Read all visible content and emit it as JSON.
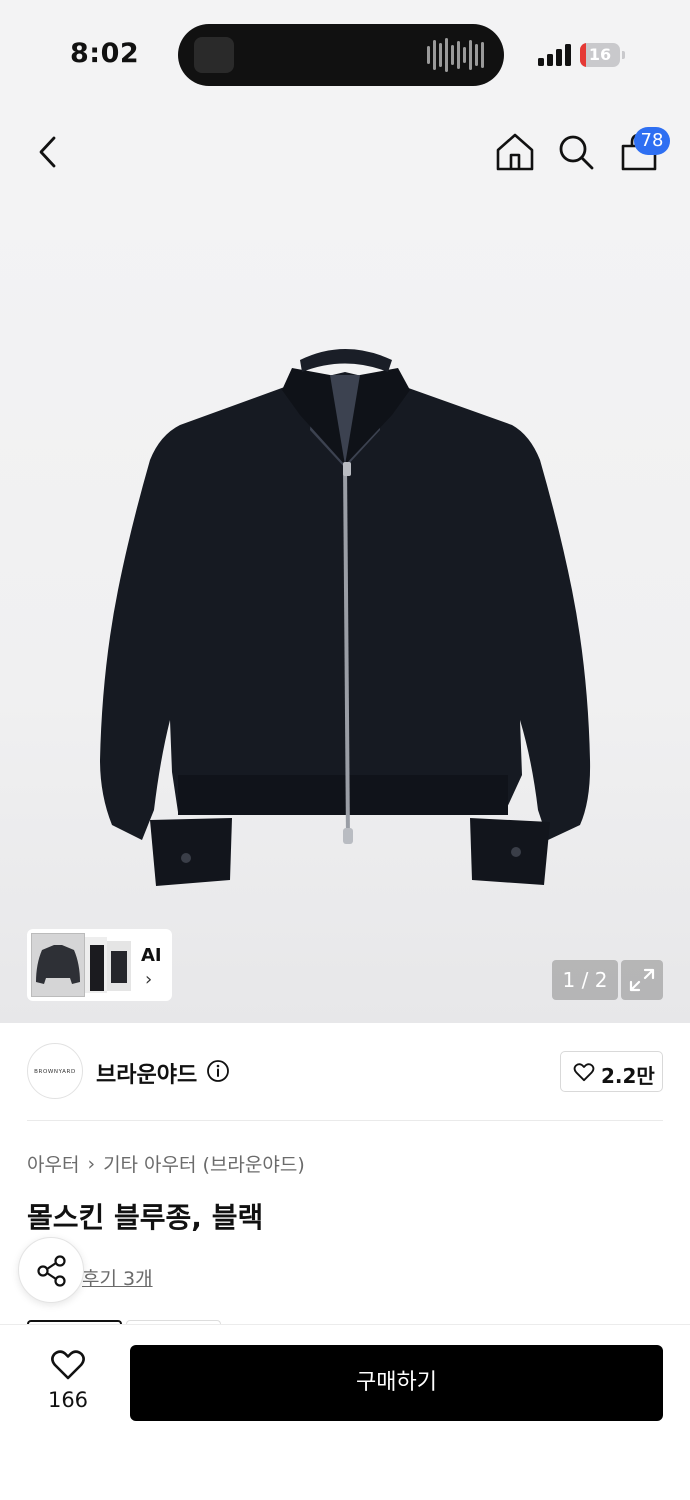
{
  "status_bar": {
    "time": "8:02",
    "battery_level": "16",
    "battery_fraction": 0.16
  },
  "header": {
    "back_icon": "chevron-left-icon",
    "home_icon": "home-icon",
    "search_icon": "search-icon",
    "cart_icon": "shopping-bag-icon",
    "cart_count": "78"
  },
  "gallery": {
    "ai_label": "AI",
    "counter": "1 / 2",
    "expand_icon": "expand-icon"
  },
  "brand": {
    "logo_text": "BROWNYARD",
    "name": "브라운야드",
    "like_count": "2.2만"
  },
  "product": {
    "breadcrumb": [
      "아우터",
      "기타 아우터 (브라운야드)"
    ],
    "title": "몰스킨 블루종, 블랙",
    "review_link": "후기 3개"
  },
  "bottom_bar": {
    "wish_count": "166",
    "buy_label": "구매하기"
  },
  "colors": {
    "accent": "#2e6ff2",
    "buy_button": "#000000",
    "battery_low": "#e53935"
  }
}
